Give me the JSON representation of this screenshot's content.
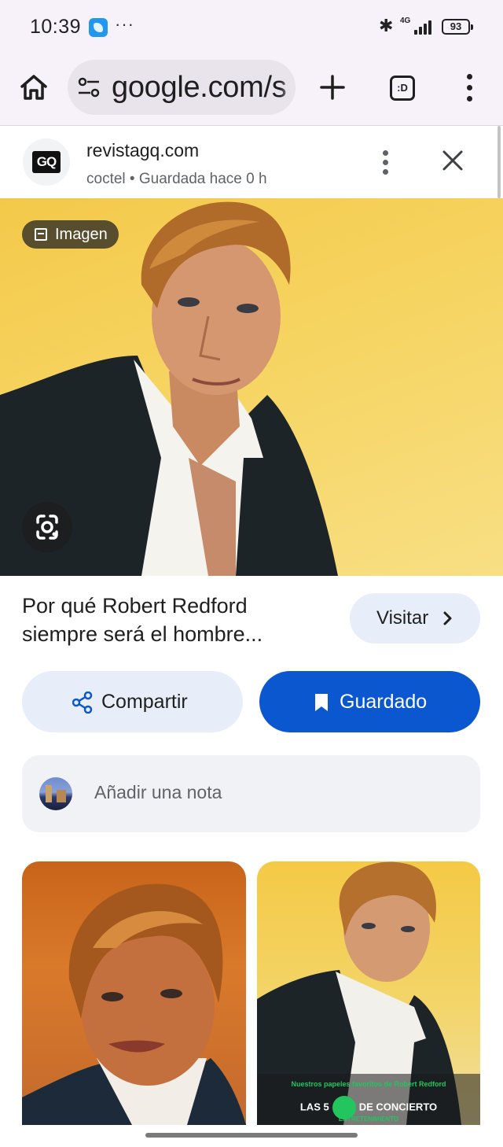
{
  "status_bar": {
    "time": "10:39",
    "overflow_dots": "···",
    "network": "4G",
    "battery": "93"
  },
  "browser": {
    "url": "google.com/s",
    "tabs_label": ":D"
  },
  "source": {
    "logo_text": "GQ",
    "domain": "revistagq.com",
    "meta": "coctel • Guardada hace 0 h"
  },
  "image": {
    "chip_label": "Imagen"
  },
  "result": {
    "title": "Por qué Robert Redford siempre será el hombre...",
    "visit_label": "Visitar"
  },
  "actions": {
    "share_label": "Compartir",
    "saved_label": "Guardado"
  },
  "note": {
    "placeholder": "Añadir una nota"
  },
  "related": {
    "overlay_top": "Nuestros papeles favoritos de Robert Redford",
    "overlay_left": "LAS 5",
    "overlay_right": "DE CONCIERTO",
    "overlay_bottom": "ENTRETENIMIENTO"
  },
  "colors": {
    "accent": "#0b57d0",
    "tonal": "#e8eef9",
    "toolbar": "#f7f2f9",
    "image_bg": "#f6d461"
  }
}
